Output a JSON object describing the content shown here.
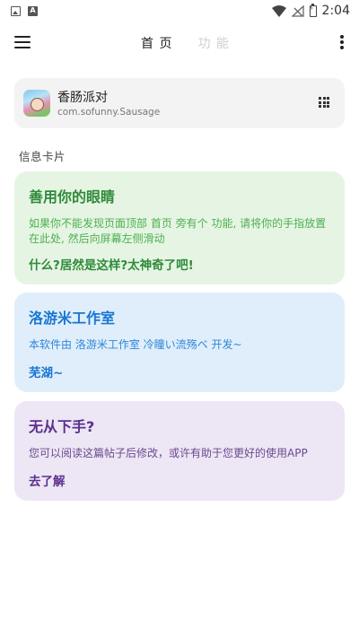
{
  "status_bar": {
    "time": "2:04",
    "left_icons": [
      "image-icon",
      "letter-a-icon"
    ],
    "right_icons": [
      "wifi-icon",
      "no-signal-icon",
      "battery-charging-icon"
    ],
    "letter_icon_text": "A"
  },
  "app_bar": {
    "tabs": [
      {
        "label": "首 页",
        "active": true
      },
      {
        "label": "功 能",
        "active": false
      }
    ]
  },
  "app_card": {
    "name": "香肠派对",
    "package": "com.sofunny.Sausage"
  },
  "section_title": "信息卡片",
  "cards": [
    {
      "title": "善用你的眼睛",
      "body": "如果你不能发现页面顶部 首页 旁有个 功能, 请将你的手指放置在此处, 然后向屏幕左侧滑动",
      "footer": "什么?居然是这样?太神奇了吧!",
      "color": "#2e8b3a",
      "background": "#e6f5e3"
    },
    {
      "title": "洛游米工作室",
      "body": "本软件由 洛游米工作室 冷瞳い流殇ベ 开发~",
      "footer": "芜湖~",
      "color": "#1976d2",
      "background": "#e0eefc"
    },
    {
      "title": "无从下手?",
      "body": "您可以阅读这篇帖子后修改，或许有助于您更好的使用APP",
      "footer": "去了解",
      "color": "#5b2f8c",
      "background": "#ede6f5"
    }
  ]
}
